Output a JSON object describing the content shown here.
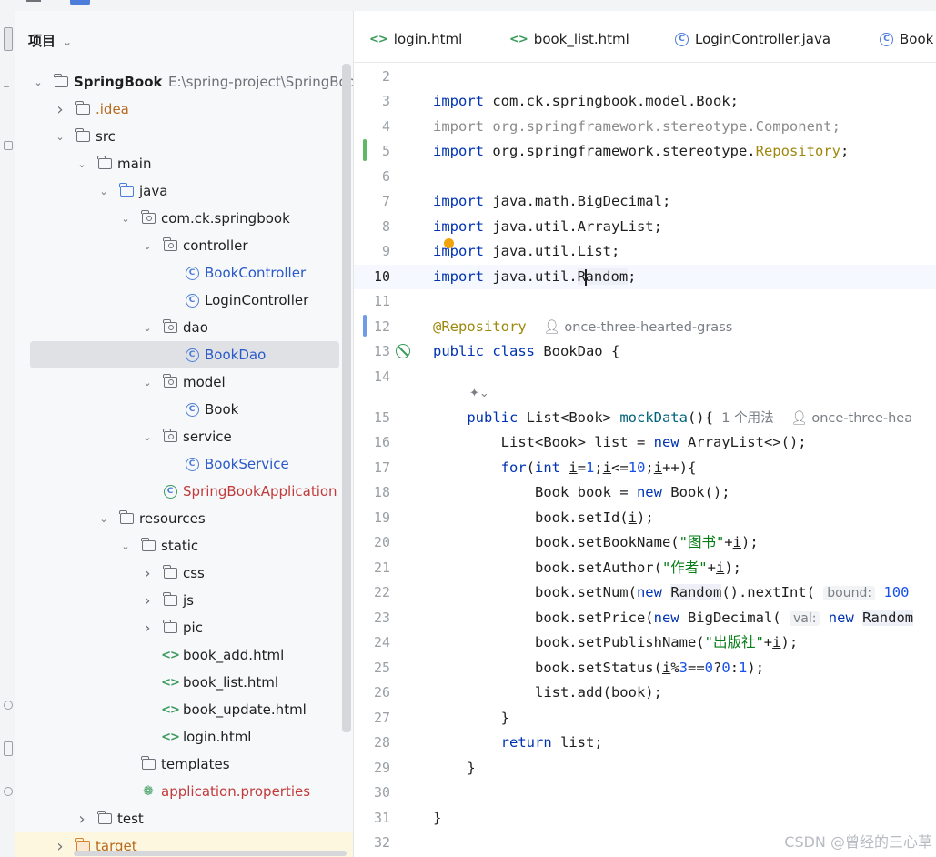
{
  "project_panel": {
    "title": "项目",
    "tree": [
      {
        "label": "SpringBook",
        "path": "E:\\spring-project\\SpringBook",
        "depth": 0,
        "kind": "module",
        "arrow": "down"
      },
      {
        "label": ".idea",
        "depth": 1,
        "kind": "folder",
        "arrow": "right",
        "color": "orange"
      },
      {
        "label": "src",
        "depth": 1,
        "kind": "folder",
        "arrow": "down"
      },
      {
        "label": "main",
        "depth": 2,
        "kind": "folder",
        "arrow": "down"
      },
      {
        "label": "java",
        "depth": 3,
        "kind": "folder-blue",
        "arrow": "down"
      },
      {
        "label": "com.ck.springbook",
        "depth": 4,
        "kind": "package",
        "arrow": "down"
      },
      {
        "label": "controller",
        "depth": 5,
        "kind": "package",
        "arrow": "down"
      },
      {
        "label": "BookController",
        "depth": 6,
        "kind": "class",
        "color": "blue"
      },
      {
        "label": "LoginController",
        "depth": 6,
        "kind": "class"
      },
      {
        "label": "dao",
        "depth": 5,
        "kind": "package",
        "arrow": "down"
      },
      {
        "label": "BookDao",
        "depth": 6,
        "kind": "class",
        "color": "blue",
        "selected": true
      },
      {
        "label": "model",
        "depth": 5,
        "kind": "package",
        "arrow": "down"
      },
      {
        "label": "Book",
        "depth": 6,
        "kind": "class"
      },
      {
        "label": "service",
        "depth": 5,
        "kind": "package",
        "arrow": "down"
      },
      {
        "label": "BookService",
        "depth": 6,
        "kind": "class",
        "color": "blue"
      },
      {
        "label": "SpringBookApplication",
        "depth": 5,
        "kind": "spring-class",
        "color": "red"
      },
      {
        "label": "resources",
        "depth": 3,
        "kind": "resources",
        "arrow": "down"
      },
      {
        "label": "static",
        "depth": 4,
        "kind": "folder",
        "arrow": "down"
      },
      {
        "label": "css",
        "depth": 5,
        "kind": "folder",
        "arrow": "right"
      },
      {
        "label": "js",
        "depth": 5,
        "kind": "folder",
        "arrow": "right"
      },
      {
        "label": "pic",
        "depth": 5,
        "kind": "folder",
        "arrow": "right"
      },
      {
        "label": "book_add.html",
        "depth": 5,
        "kind": "html"
      },
      {
        "label": "book_list.html",
        "depth": 5,
        "kind": "html"
      },
      {
        "label": "book_update.html",
        "depth": 5,
        "kind": "html"
      },
      {
        "label": "login.html",
        "depth": 5,
        "kind": "html"
      },
      {
        "label": "templates",
        "depth": 4,
        "kind": "folder"
      },
      {
        "label": "application.properties",
        "depth": 4,
        "kind": "properties",
        "color": "red"
      },
      {
        "label": "test",
        "depth": 2,
        "kind": "folder",
        "arrow": "right"
      },
      {
        "label": "target",
        "depth": 1,
        "kind": "folder-orange",
        "arrow": "right",
        "color": "orange",
        "highlight": true
      }
    ]
  },
  "tabs": [
    {
      "label": "login.html",
      "icon": "html"
    },
    {
      "label": "book_list.html",
      "icon": "html"
    },
    {
      "label": "LoginController.java",
      "icon": "class"
    },
    {
      "label": "Book",
      "icon": "class"
    }
  ],
  "editor": {
    "line_numbers": [
      "2",
      "3",
      "4",
      "5",
      "6",
      "7",
      "8",
      "9",
      "10",
      "11",
      "12",
      "13",
      "14",
      "15",
      "16",
      "17",
      "18",
      "19",
      "20",
      "21",
      "22",
      "23",
      "24",
      "25",
      "26",
      "27",
      "28",
      "29",
      "30",
      "31",
      "32"
    ],
    "author": "once-three-hearted-grass",
    "author_cut": "once-three-hea",
    "usages": "1 个用法",
    "hint_bound": "bound:",
    "hint_val": "val:",
    "str_book": "\"图书\"",
    "str_author": "\"作者\"",
    "str_publisher": "\"出版社\""
  },
  "watermark": "CSDN @曾经的三心草",
  "colors": {
    "keyword": "#0033b3",
    "string": "#067d17",
    "number": "#1750eb",
    "annotation": "#9e880d",
    "vcs_added": "#5fb865",
    "vcs_modified": "#6f9be8"
  }
}
